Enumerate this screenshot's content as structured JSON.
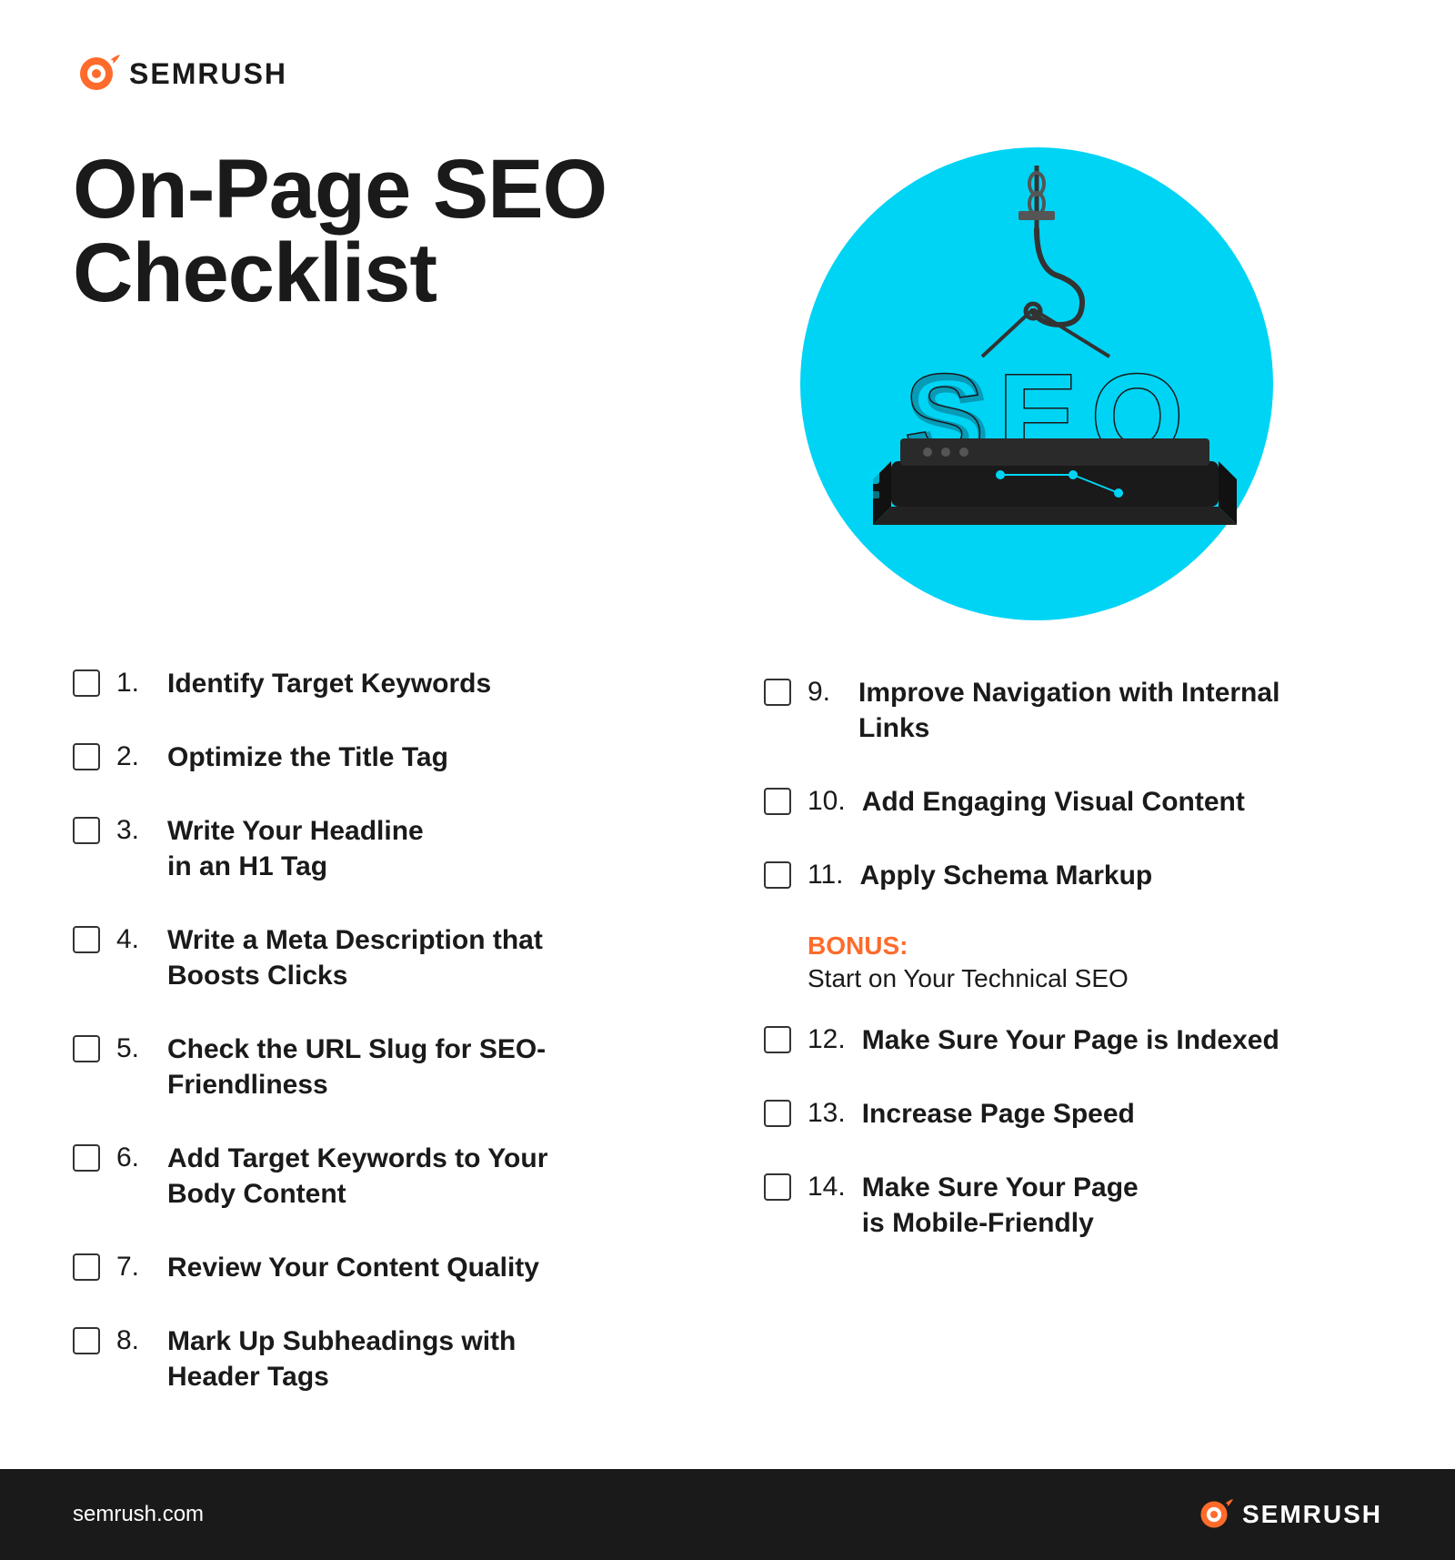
{
  "brand": {
    "name": "SEMRUSH",
    "url": "semrush.com",
    "accent_color": "#ff6b2b",
    "dark_color": "#1a1a1a",
    "cyan_color": "#00d4f5"
  },
  "page_title_line1": "On-Page SEO",
  "page_title_line2": "Checklist",
  "checklist_left": [
    {
      "number": "1.",
      "text": "Identify Target Keywords"
    },
    {
      "number": "2.",
      "text": "Optimize the Title Tag"
    },
    {
      "number": "3.",
      "text": "Write Your Headline\nin an H1 Tag"
    },
    {
      "number": "4.",
      "text": "Write a Meta Description that\nBoosts Clicks"
    },
    {
      "number": "5.",
      "text": "Check the URL Slug for SEO-\nFriendliness"
    },
    {
      "number": "6.",
      "text": "Add Target Keywords to Your\nBody Content"
    },
    {
      "number": "7.",
      "text": "Review Your Content Quality"
    },
    {
      "number": "8.",
      "text": "Mark Up Subheadings with\nHeader Tags"
    }
  ],
  "checklist_right": [
    {
      "number": "9.",
      "text": "Improve Navigation with Internal\nLinks"
    },
    {
      "number": "10.",
      "text": "Add Engaging Visual Content"
    },
    {
      "number": "11.",
      "text": "Apply Schema Markup"
    },
    {
      "number": "12.",
      "text": "Make Sure Your Page is Indexed"
    },
    {
      "number": "13.",
      "text": "Increase Page Speed"
    },
    {
      "number": "14.",
      "text": "Make Sure Your Page\nis Mobile-Friendly"
    }
  ],
  "bonus": {
    "label": "BONUS:",
    "text": "Start on Your Technical SEO"
  },
  "footer": {
    "url": "semrush.com"
  }
}
